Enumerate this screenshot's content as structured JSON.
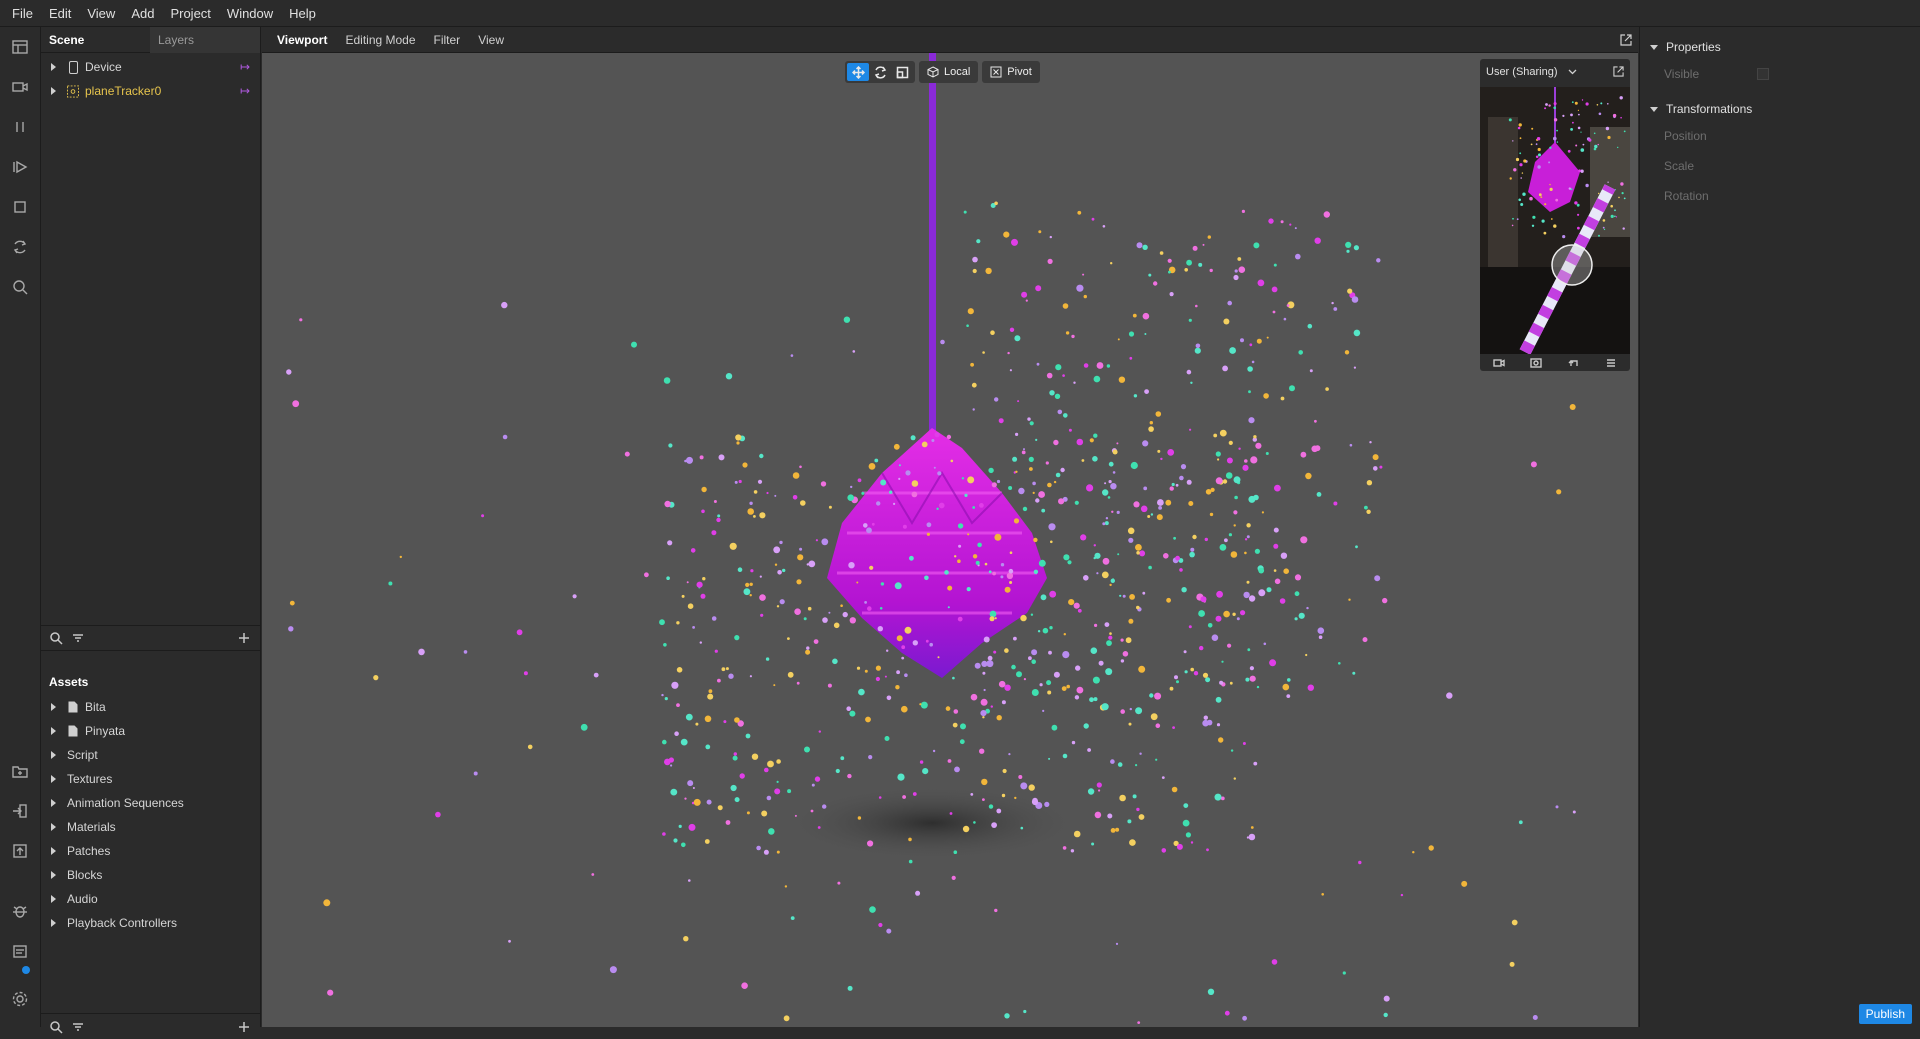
{
  "menu": [
    "File",
    "Edit",
    "View",
    "Add",
    "Project",
    "Window",
    "Help"
  ],
  "scene_panel": {
    "tabs": [
      "Scene",
      "Layers"
    ],
    "items": [
      {
        "label": "Device",
        "color": "#d6d6d6"
      },
      {
        "label": "planeTracker0",
        "color": "#e6c44d"
      }
    ]
  },
  "assets_panel": {
    "title": "Assets",
    "items": [
      "Bita",
      "Pinyata",
      "Script",
      "Textures",
      "Animation Sequences",
      "Materials",
      "Patches",
      "Blocks",
      "Audio",
      "Playback Controllers"
    ]
  },
  "viewport": {
    "tabs": [
      "Viewport",
      "Editing Mode",
      "Filter",
      "View"
    ],
    "gizmo": {
      "local_label": "Local",
      "pivot_label": "Pivot"
    },
    "preview": {
      "device_label": "User (Sharing)"
    }
  },
  "properties_panel": {
    "sections": [
      {
        "title": "Properties",
        "rows": [
          "Visible"
        ]
      },
      {
        "title": "Transformations",
        "rows": [
          "Position",
          "Scale",
          "Rotation"
        ]
      }
    ]
  },
  "publish_label": "Publish",
  "colors": {
    "accent": "#1e88e5",
    "tracker_yellow": "#e6c44d",
    "link_purple": "#b05ae0",
    "pinata_magenta": "#d21cd8"
  }
}
